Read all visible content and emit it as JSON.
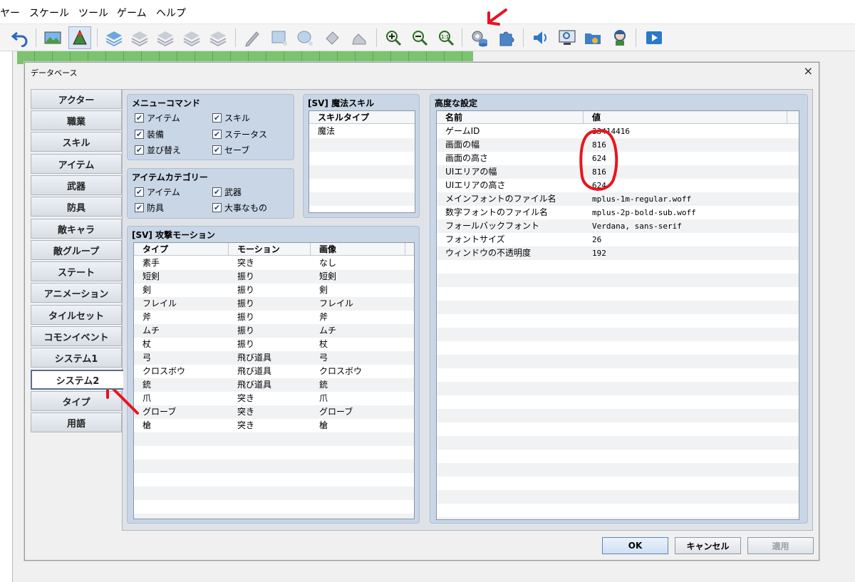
{
  "menubar": {
    "items": [
      "ヤー",
      "スケール",
      "ツール",
      "ゲーム",
      "ヘルプ"
    ]
  },
  "toolbar": {
    "buttons": [
      "undo-icon",
      "map-view-icon",
      "event-view-icon",
      "layer-1-icon",
      "layer-2-icon",
      "layer-3-icon",
      "layer-4-icon",
      "layer-5-icon",
      "pencil-icon",
      "rectangle-icon",
      "ellipse-icon",
      "flood-fill-icon",
      "shadow-pen-icon",
      "zoom-in-icon",
      "zoom-out-icon",
      "actual-size-icon",
      "database-icon",
      "plugin-manager-icon",
      "sound-test-icon",
      "event-searcher-icon",
      "resource-manager-icon",
      "character-generator-icon",
      "playtest-icon"
    ]
  },
  "dialog": {
    "title": "データベース",
    "close_label": "×"
  },
  "tabs": [
    {
      "label": "アクター",
      "selected": false
    },
    {
      "label": "職業",
      "selected": false
    },
    {
      "label": "スキル",
      "selected": false
    },
    {
      "label": "アイテム",
      "selected": false
    },
    {
      "label": "武器",
      "selected": false
    },
    {
      "label": "防具",
      "selected": false
    },
    {
      "label": "敵キャラ",
      "selected": false
    },
    {
      "label": "敵グループ",
      "selected": false
    },
    {
      "label": "ステート",
      "selected": false
    },
    {
      "label": "アニメーション",
      "selected": false
    },
    {
      "label": "タイルセット",
      "selected": false
    },
    {
      "label": "コモンイベント",
      "selected": false
    },
    {
      "label": "システム1",
      "selected": false
    },
    {
      "label": "システム2",
      "selected": true
    },
    {
      "label": "タイプ",
      "selected": false
    },
    {
      "label": "用語",
      "selected": false
    }
  ],
  "menu_commands": {
    "title": "メニューコマンド",
    "options": [
      {
        "label": "アイテム",
        "checked": true
      },
      {
        "label": "スキル",
        "checked": true
      },
      {
        "label": "装備",
        "checked": true
      },
      {
        "label": "ステータス",
        "checked": true
      },
      {
        "label": "並び替え",
        "checked": true
      },
      {
        "label": "セーブ",
        "checked": true
      }
    ]
  },
  "item_categories": {
    "title": "アイテムカテゴリー",
    "options": [
      {
        "label": "アイテム",
        "checked": true
      },
      {
        "label": "武器",
        "checked": true
      },
      {
        "label": "防具",
        "checked": true
      },
      {
        "label": "大事なもの",
        "checked": true
      }
    ]
  },
  "magic_skills": {
    "title": "[SV] 魔法スキル",
    "header": "スキルタイプ",
    "items": [
      "魔法"
    ]
  },
  "attack_motions": {
    "title": "[SV] 攻撃モーション",
    "headers": [
      "タイプ",
      "モーション",
      "画像"
    ],
    "rows": [
      [
        "素手",
        "突き",
        "なし"
      ],
      [
        "短剣",
        "振り",
        "短剣"
      ],
      [
        "剣",
        "振り",
        "剣"
      ],
      [
        "フレイル",
        "振り",
        "フレイル"
      ],
      [
        "斧",
        "振り",
        "斧"
      ],
      [
        "ムチ",
        "振り",
        "ムチ"
      ],
      [
        "杖",
        "振り",
        "杖"
      ],
      [
        "弓",
        "飛び道具",
        "弓"
      ],
      [
        "クロスボウ",
        "飛び道具",
        "クロスボウ"
      ],
      [
        "銃",
        "飛び道具",
        "銃"
      ],
      [
        "爪",
        "突き",
        "爪"
      ],
      [
        "グローブ",
        "突き",
        "グローブ"
      ],
      [
        "槍",
        "突き",
        "槍"
      ]
    ]
  },
  "advanced": {
    "title": "高度な設定",
    "headers": [
      "名前",
      "値"
    ],
    "rows": [
      [
        "ゲームID",
        "33414416"
      ],
      [
        "画面の幅",
        "816"
      ],
      [
        "画面の高さ",
        "624"
      ],
      [
        "UIエリアの幅",
        "816"
      ],
      [
        "UIエリアの高さ",
        "624"
      ],
      [
        "メインフォントのファイル名",
        "mplus-1m-regular.woff"
      ],
      [
        "数字フォントのファイル名",
        "mplus-2p-bold-sub.woff"
      ],
      [
        "フォールバックフォント",
        "Verdana, sans-serif"
      ],
      [
        "フォントサイズ",
        "26"
      ],
      [
        "ウィンドウの不透明度",
        "192"
      ]
    ]
  },
  "buttons": {
    "ok": "OK",
    "cancel": "キャンセル",
    "apply": "適用"
  },
  "annotation_color": "#e8141f"
}
